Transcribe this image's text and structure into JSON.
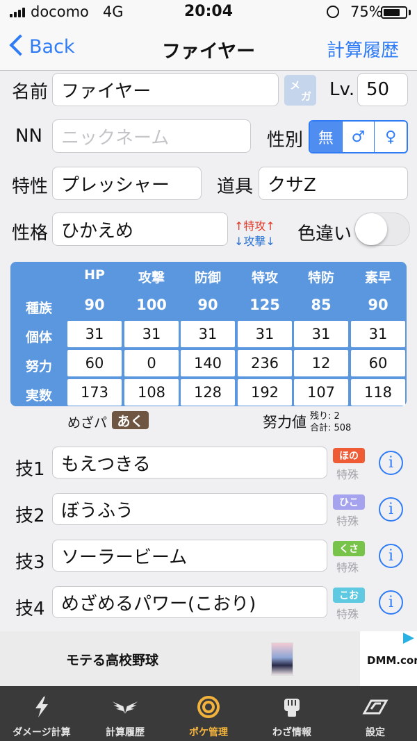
{
  "status_bar": {
    "carrier": "docomo",
    "network": "4G",
    "time": "20:04",
    "battery_percent": "75%",
    "battery_level": 0.75
  },
  "nav": {
    "back_label": "Back",
    "title": "ファイヤー",
    "right_label": "計算履歴"
  },
  "form": {
    "name_label": "名前",
    "name_value": "ファイヤー",
    "mega_label_top": "メ",
    "mega_label_bottom": "ガ",
    "level_label": "Lv.",
    "level_value": "50",
    "nickname_label": "NN",
    "nickname_placeholder": "ニックネーム",
    "gender_label": "性別",
    "gender_options": [
      "無",
      "♂",
      "♀"
    ],
    "gender_selected": "無",
    "ability_label": "特性",
    "ability_value": "プレッシャー",
    "item_label": "道具",
    "item_value": "クサZ",
    "nature_label": "性格",
    "nature_value": "ひかえめ",
    "nature_up": "↑特攻↑",
    "nature_down": "↓攻撃↓",
    "shiny_label": "色違い",
    "shiny_on": false
  },
  "stats": {
    "headers": [
      "HP",
      "攻撃",
      "防御",
      "特攻",
      "特防",
      "素早"
    ],
    "row_labels": [
      "種族",
      "個体",
      "努力",
      "実数"
    ],
    "base": [
      "90",
      "100",
      "90",
      "125",
      "85",
      "90"
    ],
    "iv": [
      "31",
      "31",
      "31",
      "31",
      "31",
      "31"
    ],
    "ev": [
      "60",
      "0",
      "140",
      "236",
      "12",
      "60"
    ],
    "actual": [
      "173",
      "108",
      "128",
      "192",
      "107",
      "118"
    ]
  },
  "hidden_power": {
    "label": "めざパ",
    "type": "あく"
  },
  "ev_summary": {
    "label": "努力値",
    "remaining": "残り: 2",
    "total": "合計: 508"
  },
  "moves": [
    {
      "label": "技1",
      "name": "もえつきる",
      "type": "ほの",
      "type_color": "#ef5b35",
      "category": "特殊"
    },
    {
      "label": "技2",
      "name": "ぼうふう",
      "type": "ひこ",
      "type_color": "#a6a3ee",
      "category": "特殊"
    },
    {
      "label": "技3",
      "name": "ソーラービーム",
      "type": "くさ",
      "type_color": "#78c34a",
      "category": "特殊"
    },
    {
      "label": "技4",
      "name": "めざめるパワー(こおり)",
      "type": "こお",
      "type_color": "#5fc9e2",
      "category": "特殊"
    }
  ],
  "ad": {
    "title": "モテる高校野球",
    "logo": "DMM.com"
  },
  "tabs": [
    {
      "label": "ダメージ計算",
      "icon": "lightning-icon",
      "active": false
    },
    {
      "label": "計算履歴",
      "icon": "wings-icon",
      "active": false
    },
    {
      "label": "ポケ管理",
      "icon": "target-rings-icon",
      "active": true
    },
    {
      "label": "わざ情報",
      "icon": "fist-icon",
      "active": false
    },
    {
      "label": "設定",
      "icon": "emblem-icon",
      "active": false
    }
  ],
  "colors": {
    "accent": "#2f7cf6",
    "stats_bg": "#5b97de",
    "tab_active": "#f2b33d",
    "tab_bg": "#3a3a3a",
    "nature_up": "#e23b2b",
    "nature_down": "#2a73d4",
    "hidden_power_badge": "#6e5643"
  }
}
